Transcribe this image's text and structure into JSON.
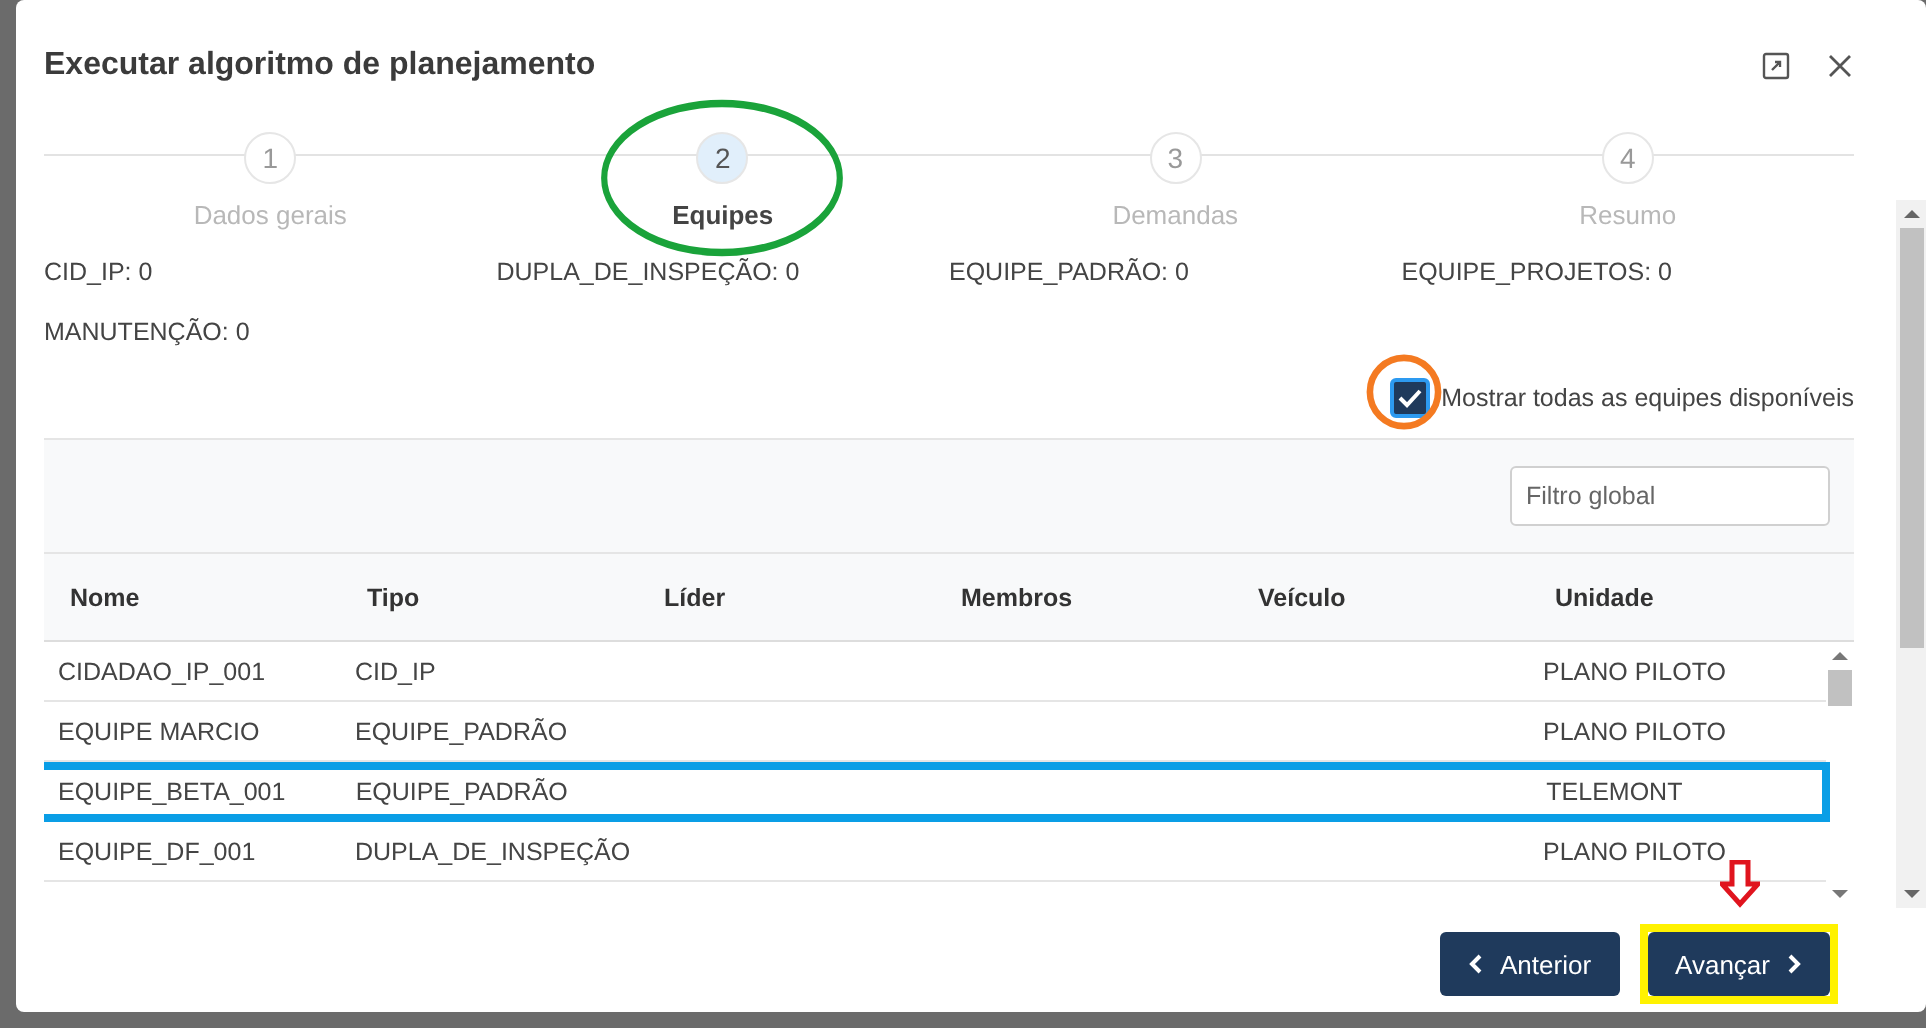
{
  "dialog": {
    "title": "Executar algoritmo de planejamento"
  },
  "steps": [
    {
      "number": "1",
      "label": "Dados gerais",
      "selected": false
    },
    {
      "number": "2",
      "label": "Equipes",
      "selected": true
    },
    {
      "number": "3",
      "label": "Demandas",
      "selected": false
    },
    {
      "number": "4",
      "label": "Resumo",
      "selected": false
    }
  ],
  "counts": [
    "CID_IP: 0",
    "DUPLA_DE_INSPEÇÃO: 0",
    "EQUIPE_PADRÃO: 0",
    "EQUIPE_PROJETOS: 0",
    "MANUTENÇÃO: 0"
  ],
  "show_all": {
    "label": "Mostrar todas as equipes disponíveis",
    "checked": true
  },
  "filter": {
    "placeholder": "Filtro global"
  },
  "table": {
    "columns": [
      "Nome",
      "Tipo",
      "Líder",
      "Membros",
      "Veículo",
      "Unidade"
    ],
    "rows": [
      {
        "cells": [
          "CIDADAO_IP_001",
          "CID_IP",
          "",
          "",
          "",
          "PLANO PILOTO"
        ],
        "highlighted": false
      },
      {
        "cells": [
          "EQUIPE MARCIO",
          "EQUIPE_PADRÃO",
          "",
          "",
          "",
          "PLANO PILOTO"
        ],
        "highlighted": false
      },
      {
        "cells": [
          "EQUIPE_BETA_001",
          "EQUIPE_PADRÃO",
          "",
          "",
          "",
          "TELEMONT"
        ],
        "highlighted": true
      },
      {
        "cells": [
          "EQUIPE_DF_001",
          "DUPLA_DE_INSPEÇÃO",
          "",
          "",
          "",
          "PLANO PILOTO"
        ],
        "highlighted": false
      }
    ]
  },
  "buttons": [
    {
      "kind": "back",
      "label": "Anterior",
      "highlighted": false
    },
    {
      "kind": "next",
      "label": "Avançar",
      "highlighted": true
    }
  ]
}
